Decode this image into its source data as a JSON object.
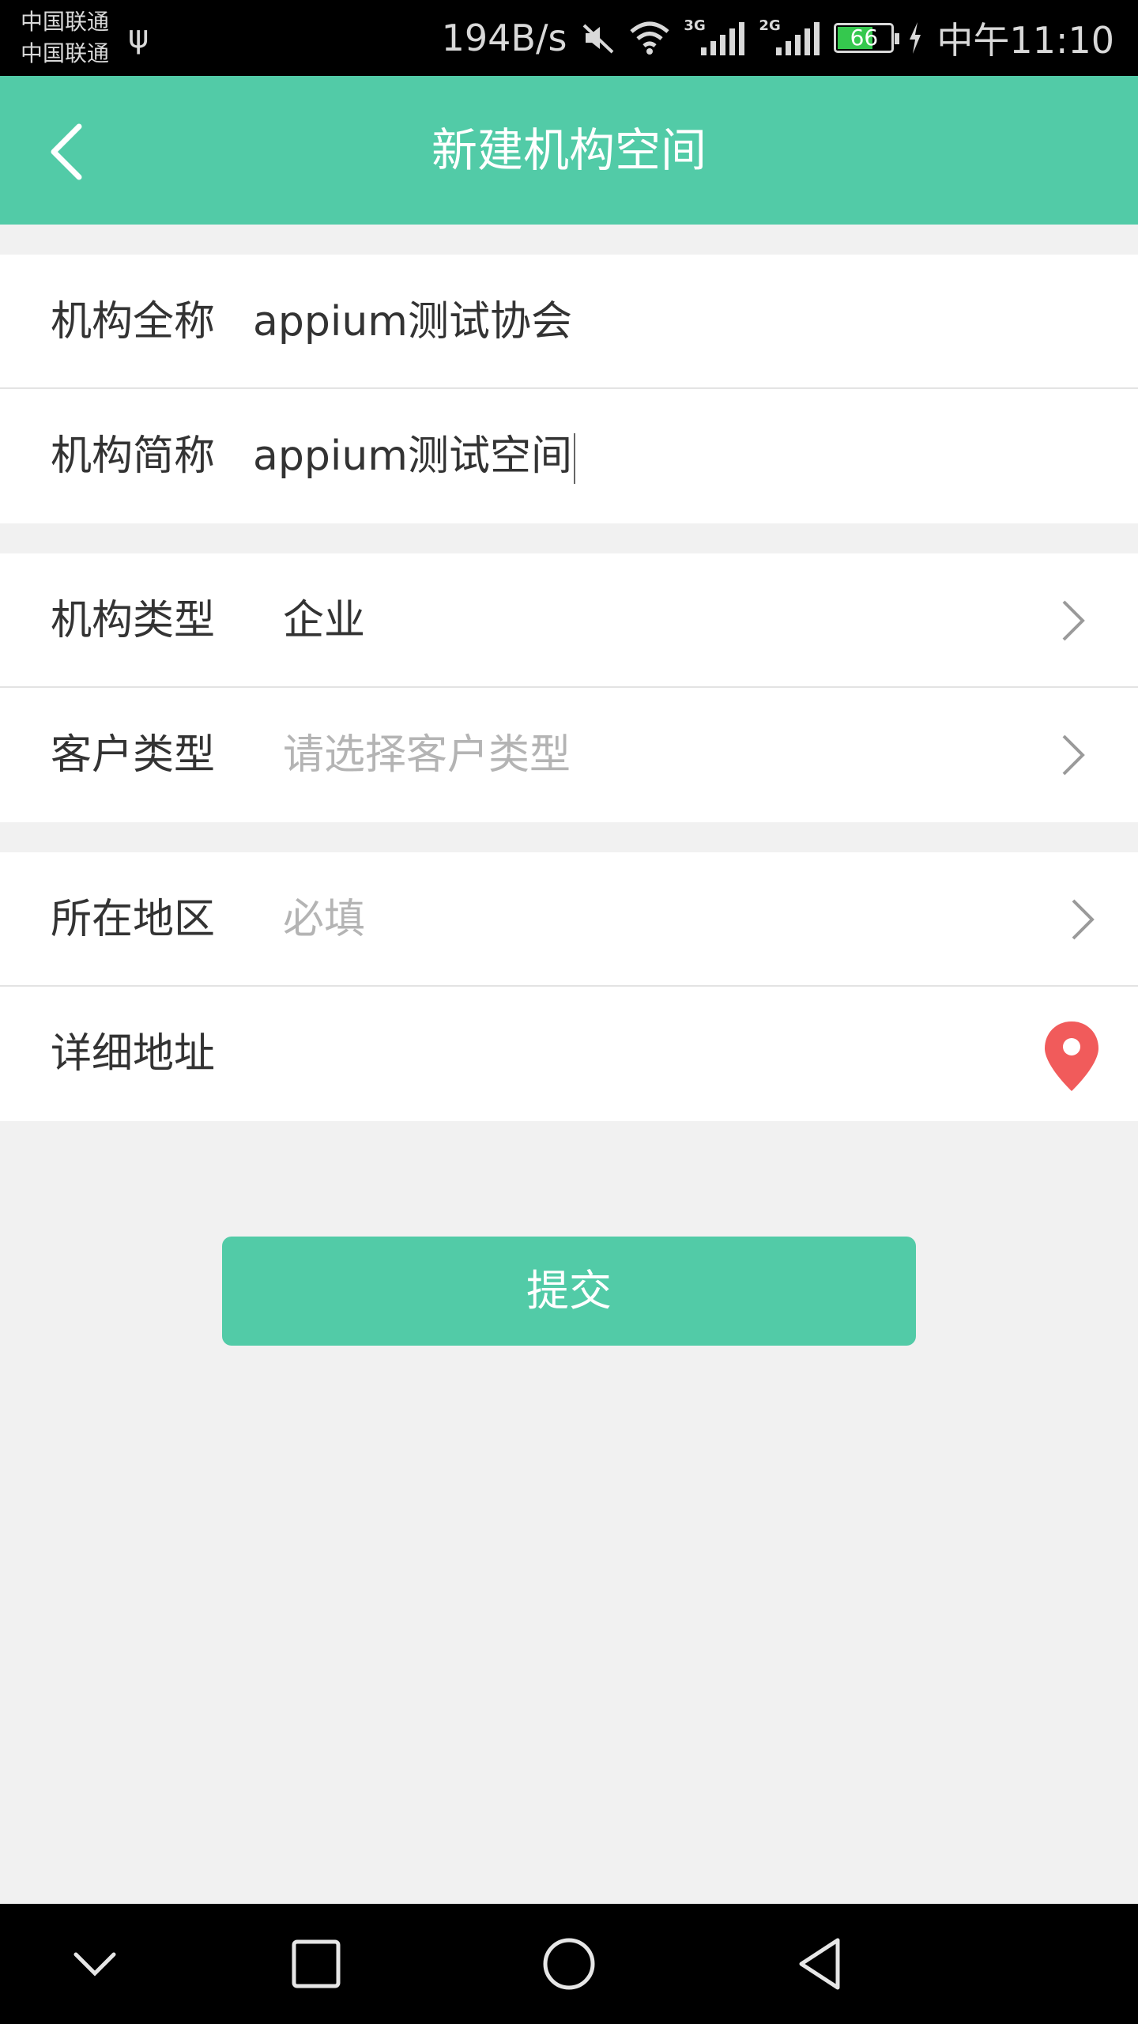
{
  "status_bar": {
    "carrier1": "中国联通",
    "carrier2": "中国联通",
    "net_speed": "194B/s",
    "sig3g": "3G",
    "sig2g": "2G",
    "battery": "66",
    "time": "中午11:10"
  },
  "header": {
    "title": "新建机构空间"
  },
  "form": {
    "full_name": {
      "label": "机构全称",
      "value": "appium测试协会"
    },
    "short_name": {
      "label": "机构简称",
      "value": "appium测试空间"
    },
    "org_type": {
      "label": "机构类型",
      "value": "企业"
    },
    "customer_type": {
      "label": "客户类型",
      "placeholder": "请选择客户类型"
    },
    "region": {
      "label": "所在地区",
      "placeholder": "必填"
    },
    "address": {
      "label": "详细地址"
    }
  },
  "submit_label": "提交",
  "colors": {
    "accent": "#52cba7",
    "pin": "#f15b5b"
  }
}
